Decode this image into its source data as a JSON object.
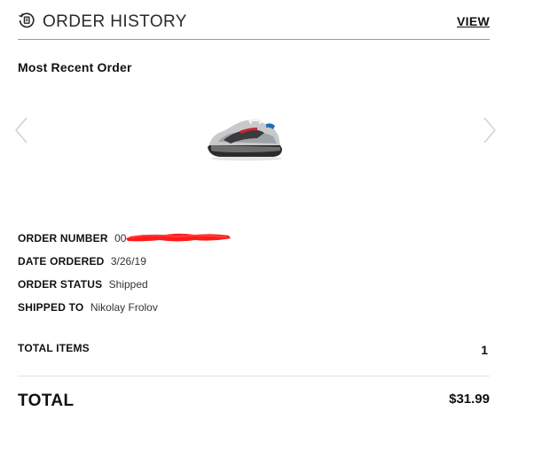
{
  "header": {
    "title": "ORDER HISTORY",
    "view_link": "VIEW",
    "icon": "order-history-icon"
  },
  "section": {
    "title": "Most Recent Order"
  },
  "carousel": {
    "prev_icon": "chevron-left-icon",
    "next_icon": "chevron-right-icon",
    "product_image": "sneaker-product-image"
  },
  "order": {
    "number_label": "ORDER NUMBER",
    "number_value": "00",
    "date_label": "DATE ORDERED",
    "date_value": "3/26/19",
    "status_label": "ORDER STATUS",
    "status_value": "Shipped",
    "shipped_to_label": "SHIPPED TO",
    "shipped_to_value": "Nikolay Frolov"
  },
  "totals": {
    "items_label": "TOTAL ITEMS",
    "items_value": "1",
    "total_label": "TOTAL",
    "total_value": "$31.99"
  },
  "colors": {
    "redaction": "#ff1a1a",
    "divider": "#9a9a9a",
    "text": "#111111"
  }
}
